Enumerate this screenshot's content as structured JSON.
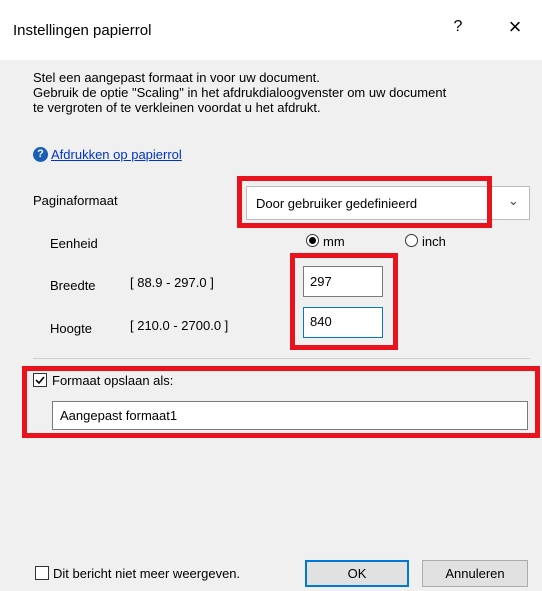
{
  "dialog": {
    "title": "Instellingen papierrol",
    "help_button": "?",
    "close_button": "×"
  },
  "intro": {
    "line1": "Stel een aangepast formaat in voor uw document.",
    "line2": "Gebruik de optie \"Scaling\" in het afdrukdialoogvenster om uw document",
    "line3": "te vergroten of te verkleinen voordat u het afdrukt."
  },
  "help_link": {
    "icon": "question-circle-icon",
    "label": "Afdrukken op papierrol"
  },
  "paper_size": {
    "label": "Paginaformaat",
    "selected": "Door gebruiker gedefinieerd"
  },
  "unit": {
    "label": "Eenheid",
    "options": [
      "mm",
      "inch"
    ],
    "selected": "mm"
  },
  "width": {
    "label": "Breedte",
    "range": "[ 88.9 - 297.0 ]",
    "value": "297"
  },
  "height": {
    "label": "Hoogte",
    "range": "[ 210.0 - 2700.0 ]",
    "value": "840"
  },
  "save_as": {
    "checked": true,
    "label": "Formaat opslaan als:",
    "value": "Aangepast formaat1"
  },
  "footer": {
    "dont_show_checked": false,
    "dont_show_label": "Dit bericht niet meer weergeven.",
    "ok_label": "OK",
    "cancel_label": "Annuleren"
  },
  "colors": {
    "highlight": "#e8131d",
    "link": "#0033cc"
  }
}
